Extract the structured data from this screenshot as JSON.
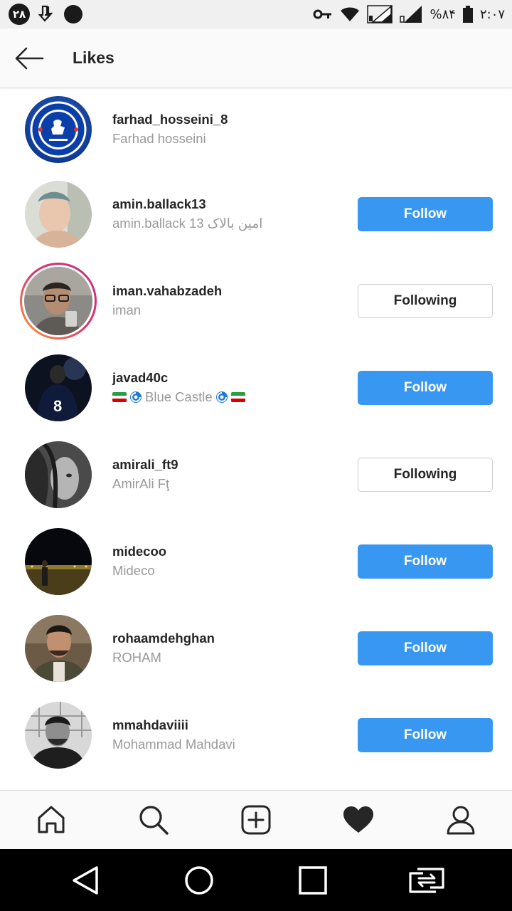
{
  "status_bar": {
    "notification_count": "۲۸",
    "battery_percent": "%۸۴",
    "time": "۲:۰۷"
  },
  "header": {
    "title": "Likes"
  },
  "likes": [
    {
      "username": "farhad_hosseini_8",
      "fullname": "Farhad hosseini",
      "button": null,
      "avatar": "chelsea-crest",
      "story_ring": false
    },
    {
      "username": "amin.ballack13",
      "fullname": "amin.ballack  امین بالاک 13",
      "button": "Follow",
      "avatar": "photo",
      "story_ring": false
    },
    {
      "username": "iman.vahabzadeh",
      "fullname": "iman",
      "button": "Following",
      "avatar": "photo",
      "story_ring": true
    },
    {
      "username": "javad40c",
      "fullname": "Blue Castle",
      "button": "Follow",
      "avatar": "photo",
      "story_ring": false
    },
    {
      "username": "amirali_ft9",
      "fullname": "AmirAli Fţ",
      "button": "Following",
      "avatar": "photo",
      "story_ring": false
    },
    {
      "username": "midecoo",
      "fullname": "Mideco",
      "button": "Follow",
      "avatar": "photo",
      "story_ring": false
    },
    {
      "username": "rohaamdehghan",
      "fullname": "ROHAM",
      "button": "Follow",
      "avatar": "photo",
      "story_ring": false
    },
    {
      "username": "mmahdaviiii",
      "fullname": "Mohammad Mahdavi",
      "button": "Follow",
      "avatar": "photo",
      "story_ring": false
    }
  ],
  "bottom_nav": {
    "items": [
      "home-icon",
      "search-icon",
      "add-post-icon",
      "heart-icon",
      "profile-icon"
    ]
  },
  "colors": {
    "follow_blue": "#3897f0",
    "text_primary": "#262626",
    "text_secondary": "#999999"
  }
}
